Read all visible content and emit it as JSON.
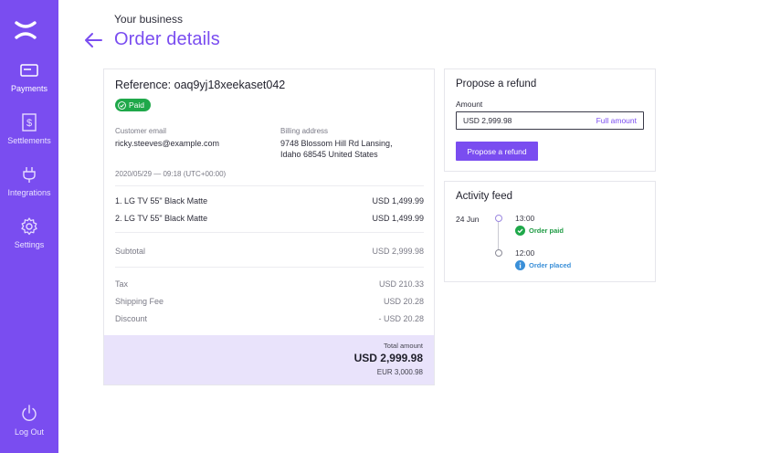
{
  "sidebar": {
    "items": [
      {
        "label": "Payments",
        "icon": "card-icon"
      },
      {
        "label": "Settlements",
        "icon": "document-dollar-icon"
      },
      {
        "label": "Integrations",
        "icon": "plug-icon"
      },
      {
        "label": "Settings",
        "icon": "gear-icon"
      }
    ],
    "logout": {
      "label": "Log Out",
      "icon": "power-icon"
    }
  },
  "header": {
    "subtitle": "Your business",
    "title": "Order details"
  },
  "order": {
    "reference": "Reference: oaq9yj18xeekaset042",
    "status": "Paid",
    "customer_email_label": "Customer email",
    "customer_email": "ricky.steeves@example.com",
    "billing_label": "Billing address",
    "billing_line1": "9748 Blossom Hill Rd Lansing,",
    "billing_line2": "Idaho 68545 United States",
    "date": "2020/05/29 — 09:18 (UTC+00:00)",
    "items": [
      {
        "name": "1. LG TV 55\" Black Matte",
        "price": "USD 1,499.99"
      },
      {
        "name": "2. LG TV 55\" Black Matte",
        "price": "USD 1,499.99"
      }
    ],
    "subtotal_label": "Subtotal",
    "subtotal": "USD 2,999.98",
    "tax_label": "Tax",
    "tax": "USD 210.33",
    "shipping_label": "Shipping Fee",
    "shipping": "USD 20.28",
    "discount_label": "Discount",
    "discount": "- USD 20.28",
    "total_label": "Total amount",
    "total_usd": "USD 2,999.98",
    "total_eur": "EUR 3,000.98"
  },
  "refund": {
    "title": "Propose a refund",
    "amount_label": "Amount",
    "amount_value": "USD 2,999.98",
    "full_amount": "Full amount",
    "button": "Propose a refund"
  },
  "activity": {
    "title": "Activity feed",
    "date": "24 Jun",
    "events": [
      {
        "time": "13:00",
        "status": "Order paid",
        "icon": "check-circle-icon",
        "color": "#1f9b44"
      },
      {
        "time": "12:00",
        "status": "Order placed",
        "icon": "info-circle-icon",
        "color": "#3a8fd8"
      }
    ]
  },
  "colors": {
    "accent": "#7a4df0",
    "paid": "#1fa84a",
    "info": "#3a8fd8",
    "total_bg": "#e9e3fb"
  }
}
